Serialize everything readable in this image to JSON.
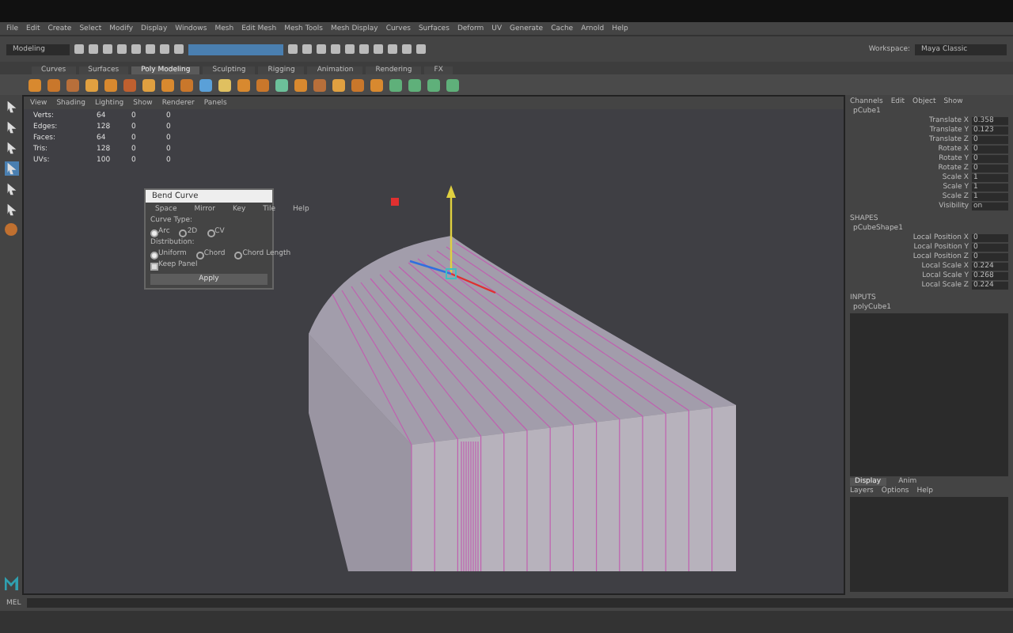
{
  "menu_bar": [
    "File",
    "Edit",
    "Create",
    "Select",
    "Modify",
    "Display",
    "Windows",
    "Mesh",
    "Edit Mesh",
    "Mesh Tools",
    "Mesh Display",
    "Curves",
    "Surfaces",
    "Deform",
    "UV",
    "Generate",
    "Cache",
    "Arnold",
    "Help"
  ],
  "status_line": {
    "mode": "Modeling",
    "workspace_label": "Workspace:",
    "workspace": "Maya Classic"
  },
  "shelf_tabs": [
    {
      "label": "Curves",
      "selected": false
    },
    {
      "label": "Surfaces",
      "selected": false
    },
    {
      "label": "Poly Modeling",
      "selected": true
    },
    {
      "label": "Sculpting",
      "selected": false
    },
    {
      "label": "Rigging",
      "selected": false
    },
    {
      "label": "Animation",
      "selected": false
    },
    {
      "label": "Rendering",
      "selected": false
    },
    {
      "label": "FX",
      "selected": false
    }
  ],
  "panel_menu": [
    "View",
    "Shading",
    "Lighting",
    "Show",
    "Renderer",
    "Panels"
  ],
  "hud_stats": [
    {
      "label": "Verts:",
      "values": [
        "64",
        "0",
        "0"
      ]
    },
    {
      "label": "Edges:",
      "values": [
        "128",
        "0",
        "0"
      ]
    },
    {
      "label": "Faces:",
      "values": [
        "64",
        "0",
        "0"
      ]
    },
    {
      "label": "Tris:",
      "values": [
        "128",
        "0",
        "0"
      ]
    },
    {
      "label": "UVs:",
      "values": [
        "100",
        "0",
        "0"
      ]
    }
  ],
  "dialog": {
    "title": "Bend Curve",
    "menu": [
      "Space",
      "Mirror",
      "Key",
      "Tile",
      "Help"
    ],
    "section_1": "Curve Type:",
    "radios_1": [
      {
        "label": "Arc",
        "selected": true
      },
      {
        "label": "2D",
        "selected": false
      },
      {
        "label": "CV",
        "selected": false
      }
    ],
    "section_2": "Distribution:",
    "radios_2": [
      {
        "label": "Uniform",
        "selected": true
      },
      {
        "label": "Chord",
        "selected": false
      },
      {
        "label": "Chord Length",
        "selected": false
      }
    ],
    "checkbox": {
      "label": "Keep Panel",
      "checked": true
    },
    "apply": "Apply"
  },
  "channel_box": {
    "menu": [
      "Channels",
      "Edit",
      "Object",
      "Show"
    ],
    "object": "pCube1",
    "channels": [
      {
        "name": "Translate X",
        "value": "0.358"
      },
      {
        "name": "Translate Y",
        "value": "0.123"
      },
      {
        "name": "Translate Z",
        "value": "0"
      },
      {
        "name": "Rotate X",
        "value": "0"
      },
      {
        "name": "Rotate Y",
        "value": "0"
      },
      {
        "name": "Rotate Z",
        "value": "0"
      },
      {
        "name": "Scale X",
        "value": "1"
      },
      {
        "name": "Scale Y",
        "value": "1"
      },
      {
        "name": "Scale Z",
        "value": "1"
      },
      {
        "name": "Visibility",
        "value": "on"
      }
    ],
    "shapes_heading": "SHAPES",
    "shape_name": "pCubeShape1",
    "shape_channels": [
      {
        "name": "Local Position X",
        "value": "0"
      },
      {
        "name": "Local Position Y",
        "value": "0"
      },
      {
        "name": "Local Position Z",
        "value": "0"
      },
      {
        "name": "Local Scale X",
        "value": "0.224"
      },
      {
        "name": "Local Scale Y",
        "value": "0.268"
      },
      {
        "name": "Local Scale Z",
        "value": "0.224"
      }
    ],
    "inputs_heading": "INPUTS",
    "input_name": "polyCube1"
  },
  "layer_editor": {
    "tabs": [
      {
        "label": "Display",
        "selected": true
      },
      {
        "label": "Anim",
        "selected": false
      }
    ],
    "menu": [
      "Layers",
      "Options",
      "Help"
    ]
  },
  "command_line": {
    "label": "MEL"
  }
}
